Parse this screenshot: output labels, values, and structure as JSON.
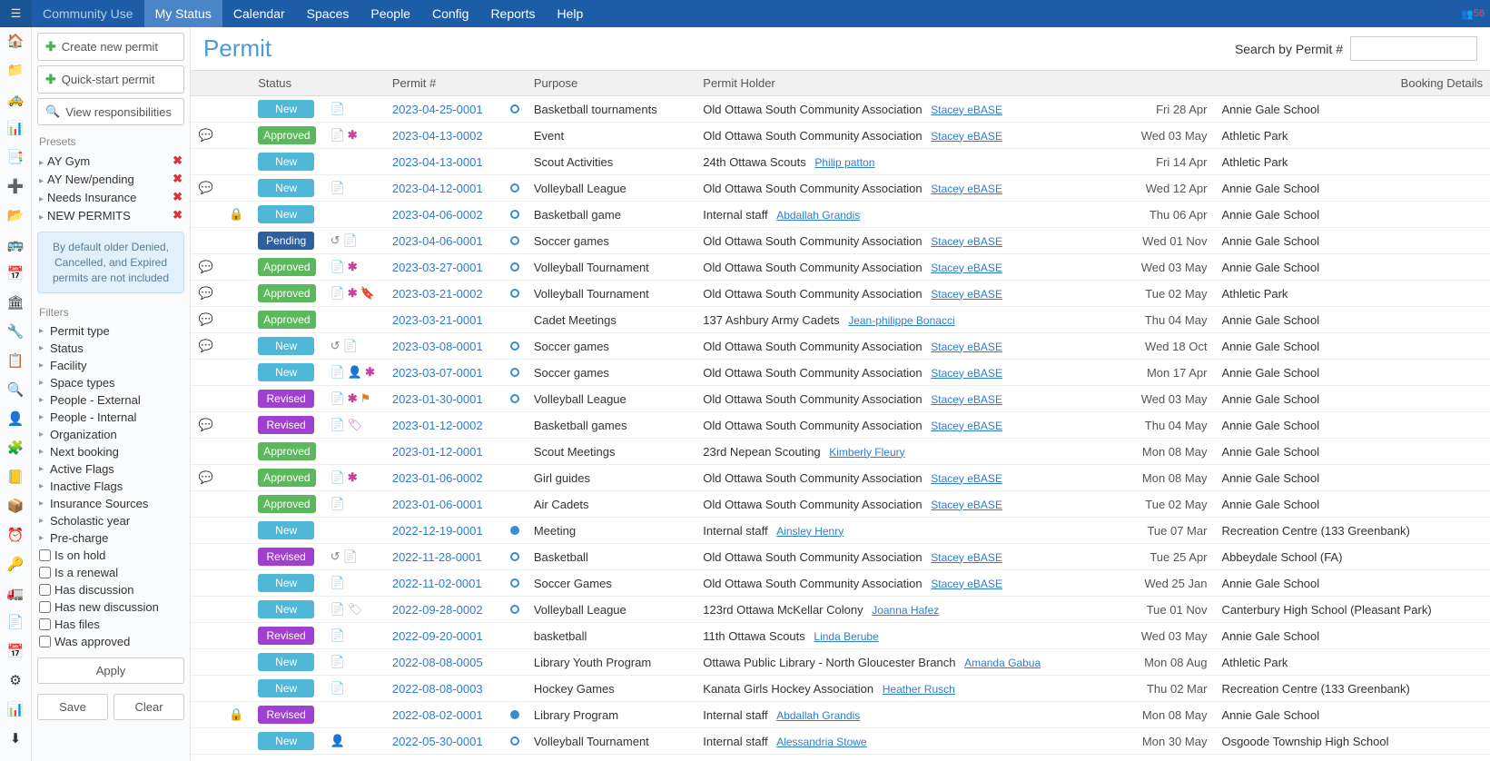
{
  "topnav": {
    "items": [
      "Community Use",
      "My Status",
      "Calendar",
      "Spaces",
      "People",
      "Config",
      "Reports",
      "Help"
    ],
    "active": 1,
    "dim": 0,
    "badge": "56"
  },
  "sidebar": {
    "btn_create": "Create new permit",
    "btn_quick": "Quick-start permit",
    "btn_resp": "View responsibilities",
    "presets_label": "Presets",
    "presets": [
      "AY Gym",
      "AY New/pending",
      "Needs Insurance",
      "NEW PERMITS"
    ],
    "info": "By default older Denied, Cancelled, and Expired permits are not included",
    "filters_label": "Filters",
    "filters_expand": [
      "Permit type",
      "Status",
      "Facility",
      "Space types",
      "People - External",
      "People - Internal",
      "Organization",
      "Next booking",
      "Active Flags",
      "Inactive Flags",
      "Insurance Sources",
      "Scholastic year",
      "Pre-charge"
    ],
    "filters_check": [
      "Is on hold",
      "Is a renewal",
      "Has discussion",
      "Has new discussion",
      "Has files",
      "Was approved"
    ],
    "btn_apply": "Apply",
    "btn_save": "Save",
    "btn_clear": "Clear"
  },
  "page": {
    "title": "Permit",
    "search_label": "Search by Permit #"
  },
  "cols": [
    "Status",
    "Permit #",
    "Purpose",
    "Permit Holder",
    "Booking Details"
  ],
  "rows": [
    {
      "disc": "",
      "lock": "",
      "status": "New",
      "icons": [
        "doc"
      ],
      "permit": "2023-04-25-0001",
      "circ": "o",
      "purpose": "Basketball tournaments",
      "holder": "Old Ottawa South Community Association",
      "contact": "Stacey eBASE",
      "date": "Fri 28 Apr",
      "loc": "Annie Gale School"
    },
    {
      "disc": "g",
      "lock": "",
      "status": "Approved",
      "icons": [
        "doc",
        "asterisk"
      ],
      "permit": "2023-04-13-0002",
      "circ": "",
      "purpose": "Event",
      "holder": "Old Ottawa South Community Association",
      "contact": "Stacey eBASE",
      "date": "Wed 03 May",
      "loc": "Athletic Park"
    },
    {
      "disc": "",
      "lock": "",
      "status": "New",
      "icons": [],
      "permit": "2023-04-13-0001",
      "circ": "",
      "purpose": "Scout Activities",
      "holder": "24th Ottawa Scouts",
      "contact": "Philip patton",
      "date": "Fri 14 Apr",
      "loc": "Athletic Park"
    },
    {
      "disc": "y",
      "lock": "",
      "status": "New",
      "icons": [
        "doc"
      ],
      "permit": "2023-04-12-0001",
      "circ": "o",
      "purpose": "Volleyball League",
      "holder": "Old Ottawa South Community Association",
      "contact": "Stacey eBASE",
      "date": "Wed 12 Apr",
      "loc": "Annie Gale School"
    },
    {
      "disc": "",
      "lock": "l",
      "status": "New",
      "icons": [],
      "permit": "2023-04-06-0002",
      "circ": "o",
      "purpose": "Basketball game",
      "holder": "Internal staff",
      "contact": "Abdallah Grandis",
      "date": "Thu 06 Apr",
      "loc": "Annie Gale School"
    },
    {
      "disc": "",
      "lock": "",
      "status": "Pending",
      "icons": [
        "undo",
        "doc"
      ],
      "permit": "2023-04-06-0001",
      "circ": "o",
      "purpose": "Soccer games",
      "holder": "Old Ottawa South Community Association",
      "contact": "Stacey eBASE",
      "date": "Wed 01 Nov",
      "loc": "Annie Gale School"
    },
    {
      "disc": "g",
      "lock": "",
      "status": "Approved",
      "icons": [
        "doc",
        "asterisk"
      ],
      "permit": "2023-03-27-0001",
      "circ": "o",
      "purpose": "Volleyball Tournament",
      "holder": "Old Ottawa South Community Association",
      "contact": "Stacey eBASE",
      "date": "Wed 03 May",
      "loc": "Annie Gale School"
    },
    {
      "disc": "y",
      "lock": "",
      "status": "Approved",
      "icons": [
        "doc",
        "asterisk",
        "bookmark"
      ],
      "permit": "2023-03-21-0002",
      "circ": "o",
      "purpose": "Volleyball Tournament",
      "holder": "Old Ottawa South Community Association",
      "contact": "Stacey eBASE",
      "date": "Tue 02 May",
      "loc": "Athletic Park"
    },
    {
      "disc": "g",
      "lock": "",
      "status": "Approved",
      "icons": [],
      "permit": "2023-03-21-0001",
      "circ": "",
      "purpose": "Cadet Meetings",
      "holder": "137 Ashbury Army Cadets",
      "contact": "Jean-philippe Bonacci",
      "date": "Thu 04 May",
      "loc": "Annie Gale School"
    },
    {
      "disc": "y",
      "lock": "",
      "status": "New",
      "icons": [
        "undo",
        "doc"
      ],
      "permit": "2023-03-08-0001",
      "circ": "o",
      "purpose": "Soccer games",
      "holder": "Old Ottawa South Community Association",
      "contact": "Stacey eBASE",
      "date": "Wed 18 Oct",
      "loc": "Annie Gale School"
    },
    {
      "disc": "",
      "lock": "",
      "status": "New",
      "icons": [
        "doc",
        "person",
        "asterisk"
      ],
      "permit": "2023-03-07-0001",
      "circ": "o",
      "purpose": "Soccer games",
      "holder": "Old Ottawa South Community Association",
      "contact": "Stacey eBASE",
      "date": "Mon 17 Apr",
      "loc": "Annie Gale School"
    },
    {
      "disc": "",
      "lock": "",
      "status": "Revised",
      "icons": [
        "doc",
        "asterisk",
        "flag"
      ],
      "permit": "2023-01-30-0001",
      "circ": "o",
      "purpose": "Volleyball League",
      "holder": "Old Ottawa South Community Association",
      "contact": "Stacey eBASE",
      "date": "Wed 03 May",
      "loc": "Annie Gale School"
    },
    {
      "disc": "y",
      "lock": "",
      "status": "Revised",
      "icons": [
        "doc",
        "tagp"
      ],
      "permit": "2023-01-12-0002",
      "circ": "",
      "purpose": "Basketball games",
      "holder": "Old Ottawa South Community Association",
      "contact": "Stacey eBASE",
      "date": "Thu 04 May",
      "loc": "Annie Gale School"
    },
    {
      "disc": "",
      "lock": "",
      "status": "Approved",
      "icons": [],
      "permit": "2023-01-12-0001",
      "circ": "",
      "purpose": "Scout Meetings",
      "holder": "23rd Nepean Scouting",
      "contact": "Kimberly Fleury",
      "date": "Mon 08 May",
      "loc": "Annie Gale School"
    },
    {
      "disc": "y",
      "lock": "",
      "status": "Approved",
      "icons": [
        "doc",
        "asterisk"
      ],
      "permit": "2023-01-06-0002",
      "circ": "",
      "purpose": "Girl guides",
      "holder": "Old Ottawa South Community Association",
      "contact": "Stacey eBASE",
      "date": "Mon 08 May",
      "loc": "Annie Gale School"
    },
    {
      "disc": "",
      "lock": "",
      "status": "Approved",
      "icons": [
        "doc"
      ],
      "permit": "2023-01-06-0001",
      "circ": "",
      "purpose": "Air Cadets",
      "holder": "Old Ottawa South Community Association",
      "contact": "Stacey eBASE",
      "date": "Tue 02 May",
      "loc": "Annie Gale School"
    },
    {
      "disc": "",
      "lock": "",
      "status": "New",
      "icons": [],
      "permit": "2022-12-19-0001",
      "circ": "f",
      "purpose": "Meeting",
      "holder": "Internal staff",
      "contact": "Ainsley Henry",
      "date": "Tue 07 Mar",
      "loc": "Recreation Centre (133 Greenbank)"
    },
    {
      "disc": "",
      "lock": "",
      "status": "Revised",
      "icons": [
        "undo",
        "doc"
      ],
      "permit": "2022-11-28-0001",
      "circ": "o",
      "purpose": "Basketball",
      "holder": "Old Ottawa South Community Association",
      "contact": "Stacey eBASE",
      "date": "Tue 25 Apr",
      "loc": "Abbeydale School (FA)"
    },
    {
      "disc": "",
      "lock": "",
      "status": "New",
      "icons": [
        "doc"
      ],
      "permit": "2022-11-02-0001",
      "circ": "o",
      "purpose": "Soccer Games",
      "holder": "Old Ottawa South Community Association",
      "contact": "Stacey eBASE",
      "date": "Wed 25 Jan",
      "loc": "Annie Gale School"
    },
    {
      "disc": "",
      "lock": "",
      "status": "New",
      "icons": [
        "doc",
        "tag"
      ],
      "permit": "2022-09-28-0002",
      "circ": "o",
      "purpose": "Volleyball League",
      "holder": "123rd Ottawa McKellar Colony",
      "contact": "Joanna Hafez",
      "date": "Tue 01 Nov",
      "loc": "Canterbury High School (Pleasant Park)"
    },
    {
      "disc": "",
      "lock": "",
      "status": "Revised",
      "icons": [
        "doc"
      ],
      "permit": "2022-09-20-0001",
      "circ": "",
      "purpose": "basketball",
      "holder": "11th Ottawa Scouts",
      "contact": "Linda Berube",
      "date": "Wed 03 May",
      "loc": "Annie Gale School"
    },
    {
      "disc": "",
      "lock": "",
      "status": "New",
      "icons": [
        "doc"
      ],
      "permit": "2022-08-08-0005",
      "circ": "",
      "purpose": "Library Youth Program",
      "holder": "Ottawa Public Library - North Gloucester Branch",
      "contact": "Amanda Gabua",
      "date": "Mon 08 Aug",
      "loc": "Athletic Park"
    },
    {
      "disc": "",
      "lock": "",
      "status": "New",
      "icons": [
        "doc"
      ],
      "permit": "2022-08-08-0003",
      "circ": "",
      "purpose": "Hockey Games",
      "holder": "Kanata Girls Hockey Association",
      "contact": "Heather Rusch",
      "date": "Thu 02 Mar",
      "loc": "Recreation Centre (133 Greenbank)"
    },
    {
      "disc": "",
      "lock": "l",
      "status": "Revised",
      "icons": [],
      "permit": "2022-08-02-0001",
      "circ": "f",
      "purpose": "Library Program",
      "holder": "Internal staff",
      "contact": "Abdallah Grandis",
      "date": "Mon 08 May",
      "loc": "Annie Gale School"
    },
    {
      "disc": "",
      "lock": "",
      "status": "New",
      "icons": [
        "person"
      ],
      "permit": "2022-05-30-0001",
      "circ": "o",
      "purpose": "Volleyball Tournament",
      "holder": "Internal staff",
      "contact": "Alessandria Stowe",
      "date": "Mon 30 May",
      "loc": "Osgoode Township High School"
    }
  ],
  "iconcol": [
    "🏠",
    "📁",
    "🚕",
    "📊",
    "📑",
    "➕",
    "📂",
    "🚌",
    "📅",
    "🏛",
    "🔧",
    "📋",
    "🔍",
    "👤",
    "🧩",
    "📒",
    "📦",
    "⏰",
    "🔑",
    "🚛",
    "📄",
    "📅",
    "⚙",
    "📊",
    "⬇"
  ]
}
